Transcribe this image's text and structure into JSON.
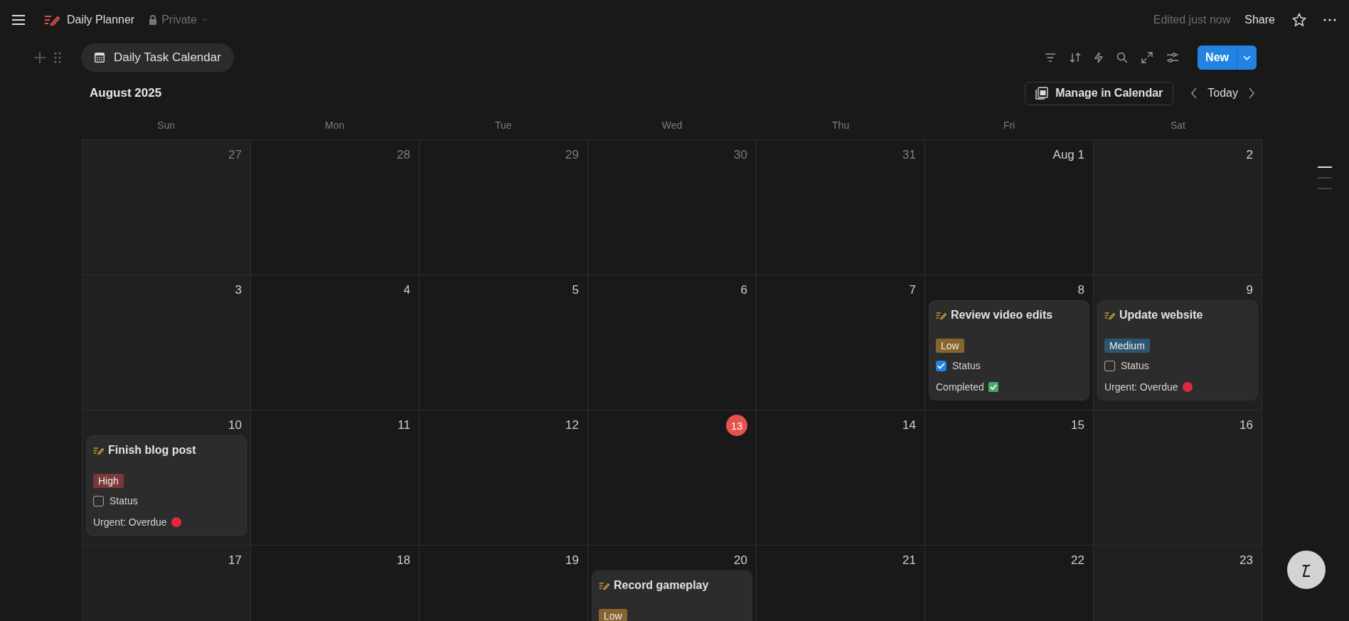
{
  "topbar": {
    "title": "Daily Planner",
    "privacy": "Private",
    "edited": "Edited just now",
    "share": "Share"
  },
  "view": {
    "tab": "Daily Task Calendar",
    "new_button": "New"
  },
  "calendar": {
    "month": "August 2025",
    "manage": "Manage in Calendar",
    "today_button": "Today",
    "weekdays": [
      "Sun",
      "Mon",
      "Tue",
      "Wed",
      "Thu",
      "Fri",
      "Sat"
    ],
    "weeks": [
      [
        {
          "label": "27",
          "in_month": false,
          "today": false
        },
        {
          "label": "28",
          "in_month": false,
          "today": false
        },
        {
          "label": "29",
          "in_month": false,
          "today": false
        },
        {
          "label": "30",
          "in_month": false,
          "today": false
        },
        {
          "label": "31",
          "in_month": false,
          "today": false
        },
        {
          "label": "Aug 1",
          "in_month": true,
          "today": false
        },
        {
          "label": "2",
          "in_month": true,
          "today": false
        }
      ],
      [
        {
          "label": "3",
          "in_month": true,
          "today": false
        },
        {
          "label": "4",
          "in_month": true,
          "today": false
        },
        {
          "label": "5",
          "in_month": true,
          "today": false
        },
        {
          "label": "6",
          "in_month": true,
          "today": false
        },
        {
          "label": "7",
          "in_month": true,
          "today": false
        },
        {
          "label": "8",
          "in_month": true,
          "today": false,
          "tasks": [
            {
              "title": "Review video edits",
              "priority": {
                "label": "Low",
                "color": "#86652f"
              },
              "status": {
                "label": "Status",
                "checked": true
              },
              "footer": {
                "kind": "completed",
                "text": "Completed"
              }
            }
          ]
        },
        {
          "label": "9",
          "in_month": true,
          "today": false,
          "tasks": [
            {
              "title": "Update website",
              "priority": {
                "label": "Medium",
                "color": "#2e5571"
              },
              "status": {
                "label": "Status",
                "checked": false
              },
              "footer": {
                "kind": "overdue",
                "text": "Urgent: Overdue"
              }
            }
          ]
        }
      ],
      [
        {
          "label": "10",
          "in_month": true,
          "today": false,
          "tasks": [
            {
              "title": "Finish blog post",
              "priority": {
                "label": "High",
                "color": "#7a3838"
              },
              "status": {
                "label": "Status",
                "checked": false
              },
              "footer": {
                "kind": "overdue",
                "text": "Urgent: Overdue"
              }
            }
          ]
        },
        {
          "label": "11",
          "in_month": true,
          "today": false
        },
        {
          "label": "12",
          "in_month": true,
          "today": false
        },
        {
          "label": "13",
          "in_month": true,
          "today": true
        },
        {
          "label": "14",
          "in_month": true,
          "today": false
        },
        {
          "label": "15",
          "in_month": true,
          "today": false
        },
        {
          "label": "16",
          "in_month": true,
          "today": false
        }
      ],
      [
        {
          "label": "17",
          "in_month": true,
          "today": false
        },
        {
          "label": "18",
          "in_month": true,
          "today": false
        },
        {
          "label": "19",
          "in_month": true,
          "today": false
        },
        {
          "label": "20",
          "in_month": true,
          "today": false,
          "tasks": [
            {
              "title": "Record gameplay",
              "priority": {
                "label": "Low",
                "color": "#86652f"
              }
            }
          ]
        },
        {
          "label": "21",
          "in_month": true,
          "today": false
        },
        {
          "label": "22",
          "in_month": true,
          "today": false
        },
        {
          "label": "23",
          "in_month": true,
          "today": false
        }
      ]
    ]
  }
}
